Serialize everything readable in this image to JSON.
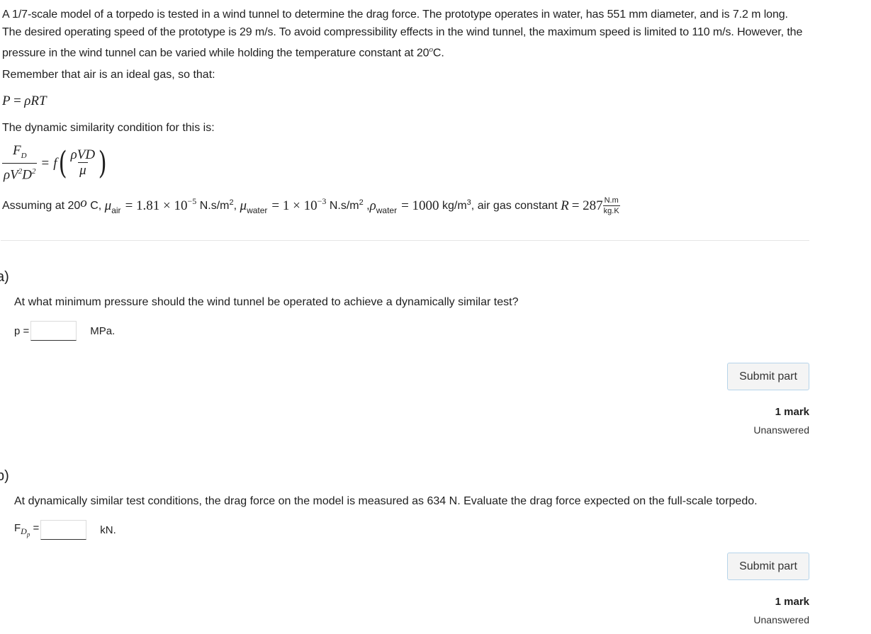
{
  "intro": {
    "problem": "A 1/7-scale model of a torpedo is tested in a wind tunnel to determine the drag force. The prototype operates in water, has 551 mm diameter, and is 7.2 m long. The desired operating speed of the prototype is 29 m/s. To avoid compressibility effects in the wind tunnel, the maximum speed is limited to 110 m/s. However, the pressure in the wind tunnel can be varied while holding the temperature constant at 20",
    "temp_sup": "o",
    "temp_unit": "C.",
    "ideal_gas_text": "Remember that air is an ideal gas, so that:",
    "ideal_gas_eq": {
      "lhs": "P",
      "eq": "=",
      "rhs": "ρRT"
    },
    "similarity_text": "The dynamic similarity condition for this is:",
    "similarity_eq": {
      "lhs_num": "F",
      "lhs_num_sub": "D",
      "lhs_den": "ρV",
      "lhs_den_sup1": "2",
      "lhs_den_D": "D",
      "lhs_den_sup2": "2",
      "eq": "=",
      "func": "f",
      "rhs_num": "ρVD",
      "rhs_den": "μ"
    },
    "assumptions": {
      "prefix": "Assuming at 20",
      "deg_sup": "o",
      "unit_c": " C, ",
      "mu_air_sym": "μ",
      "mu_air_sub": "air",
      "mu_air_val": "= 1.81 × 10",
      "mu_air_exp": "−5",
      "mu_air_unit": " N.s/m",
      "mu_air_unit_sup": "2",
      "comma1": ", ",
      "mu_water_sym": "μ",
      "mu_water_sub": "water",
      "mu_water_val": "= 1 × 10",
      "mu_water_exp": "−3",
      "mu_water_unit": " N.s/m",
      "mu_water_unit_sup": "2",
      "comma2": " ,",
      "rho_water_sym": "ρ",
      "rho_water_sub": "water",
      "rho_water_val": "= 1000",
      "rho_water_unit": " kg/m",
      "rho_water_unit_sup": "3",
      "gas_const_text": ", air gas constant ",
      "r_sym": "R",
      "r_val": "= 287",
      "r_unit_num": "N.m",
      "r_unit_den": "kg.K"
    }
  },
  "parts": [
    {
      "label": "a)",
      "question": "At what minimum pressure should the wind tunnel be operated to achieve a dynamically similar test?",
      "input_label": "p =",
      "input_value": "",
      "unit": "MPa.",
      "submit_label": "Submit part",
      "marks": "1 mark",
      "status": "Unanswered"
    },
    {
      "label": "b)",
      "question": "At dynamically similar test conditions, the drag force on the model is measured as 634 N. Evaluate the drag force expected on the full-scale torpedo.",
      "input_label_main": "F",
      "input_label_sub": "D",
      "input_label_subsub": "p",
      "input_label_eq": " =",
      "input_value": "",
      "unit": "kN.",
      "submit_label": "Submit part",
      "marks": "1 mark",
      "status": "Unanswered"
    }
  ]
}
